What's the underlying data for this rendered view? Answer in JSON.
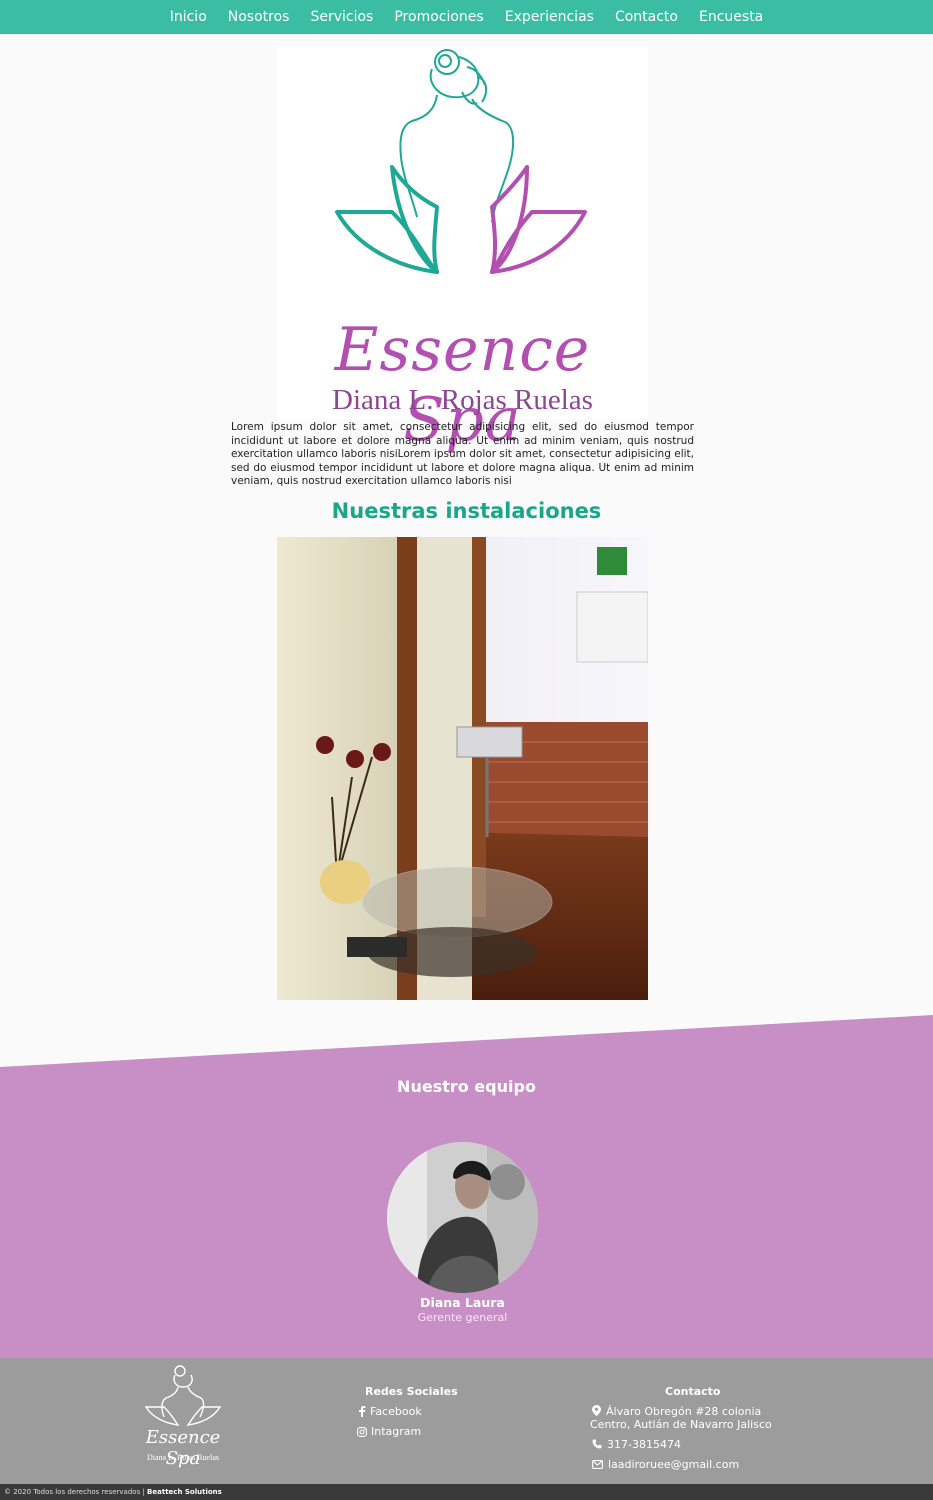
{
  "nav": {
    "items": [
      "Inicio",
      "Nosotros",
      "Servicios",
      "Promociones",
      "Experiencias",
      "Contacto",
      "Encuesta"
    ]
  },
  "logo": {
    "brand": "Essence Spa",
    "owner": "Diana L. Rojas Ruelas"
  },
  "intro": {
    "text": "Lorem ipsum dolor sit amet, consectetur adipisicing elit, sed do eiusmod tempor incididunt ut labore et dolore magna aliqua. Ut enim ad minim veniam, quis nostrud exercitation ullamco laboris nisiLorem ipsum dolor sit amet, consectetur adipisicing elit, sed do eiusmod tempor incididunt ut labore et dolore magna aliqua. Ut enim ad minim veniam, quis nostrud exercitation ullamco laboris nisi"
  },
  "installations": {
    "title": "Nuestras instalaciones"
  },
  "team": {
    "title": "Nuestro equipo",
    "members": [
      {
        "name": "Diana Laura",
        "role": "Gerente general"
      }
    ]
  },
  "footer": {
    "logo_brand": "Essence Spa",
    "logo_owner": "Diana L. Rojas Ruelas",
    "social": {
      "title": "Redes Sociales",
      "links": [
        {
          "label": "Facebook",
          "icon": "facebook-icon"
        },
        {
          "label": "Intagram",
          "icon": "instagram-icon"
        }
      ]
    },
    "contact": {
      "title": "Contacto",
      "address_line1": "Álvaro Obregón #28 colonia",
      "address_line2": "Centro, Autlán de Navarro Jalisco",
      "phone": "317-3815474",
      "email": "laadiroruee@gmail.com"
    }
  },
  "copyright": {
    "text": "© 2020 Todos los derechos reservados |",
    "company": "Beattech Solutions"
  },
  "colors": {
    "nav": "#3bbda4",
    "accent_green": "#1aa68b",
    "accent_purple": "#b24fb0",
    "team_bg": "#c88fc6",
    "footer_bg": "#9c9c9c",
    "copyright_bg": "#3a3a3a"
  }
}
